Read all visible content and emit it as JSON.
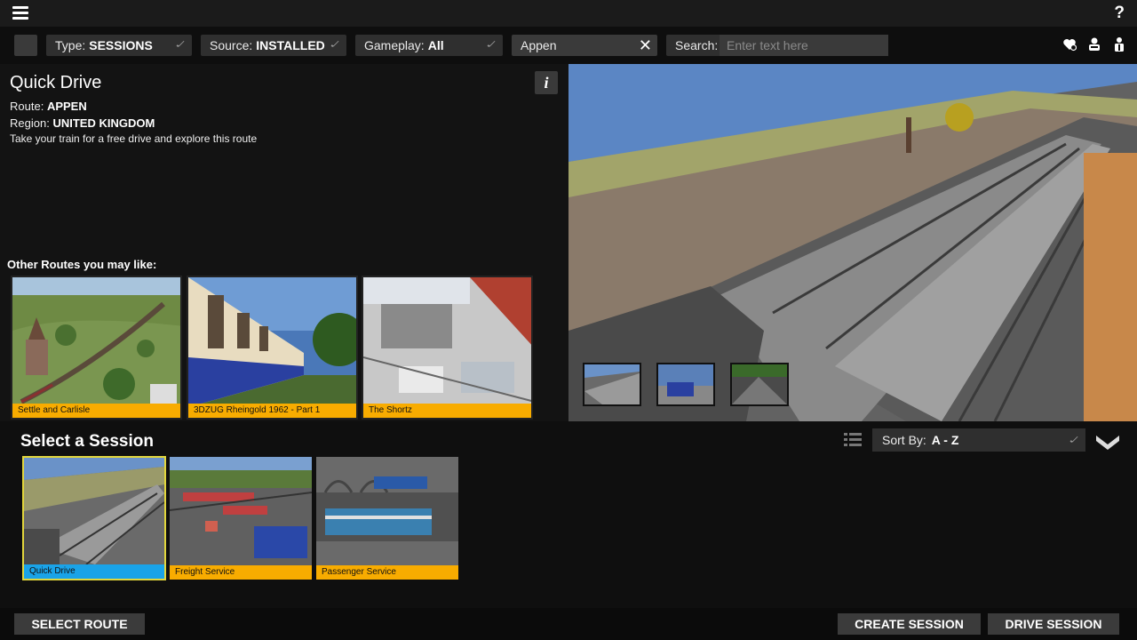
{
  "topbar": {
    "menu_icon": "hamburger-menu-icon",
    "help_label": "?"
  },
  "filters": {
    "type": {
      "label": "Type:",
      "value": "SESSIONS"
    },
    "source": {
      "label": "Source:",
      "value": "INSTALLED"
    },
    "gameplay": {
      "label": "Gameplay:",
      "value": "All"
    },
    "route_filter": {
      "value": "Appen",
      "clear": "✕"
    },
    "search": {
      "label": "Search:",
      "placeholder": "Enter text here"
    },
    "icons": [
      "favourites-icon",
      "driver-icon",
      "player-icon"
    ]
  },
  "info": {
    "title": "Quick Drive",
    "route_label": "Route:",
    "route_value": "APPEN",
    "region_label": "Region:",
    "region_value": "UNITED KINGDOM",
    "description": "Take your train for a free drive and explore this route",
    "info_button": "i",
    "other_routes_label": "Other Routes you may like:",
    "routes": [
      {
        "label": "Settle and Carlisle"
      },
      {
        "label": "3DZUG Rheingold 1962 - Part 1"
      },
      {
        "label": "The Shortz"
      }
    ]
  },
  "sessions": {
    "title": "Select a Session",
    "sort_label": "Sort By:",
    "sort_value": "A - Z",
    "items": [
      {
        "label": "Quick Drive",
        "color": "#1aa3e8"
      },
      {
        "label": "Freight Service",
        "color": "#f8ac00"
      },
      {
        "label": "Passenger Service",
        "color": "#f8ac00"
      }
    ]
  },
  "footer": {
    "select_route": "SELECT ROUTE",
    "create_session": "CREATE SESSION",
    "drive_session": "DRIVE SESSION"
  }
}
